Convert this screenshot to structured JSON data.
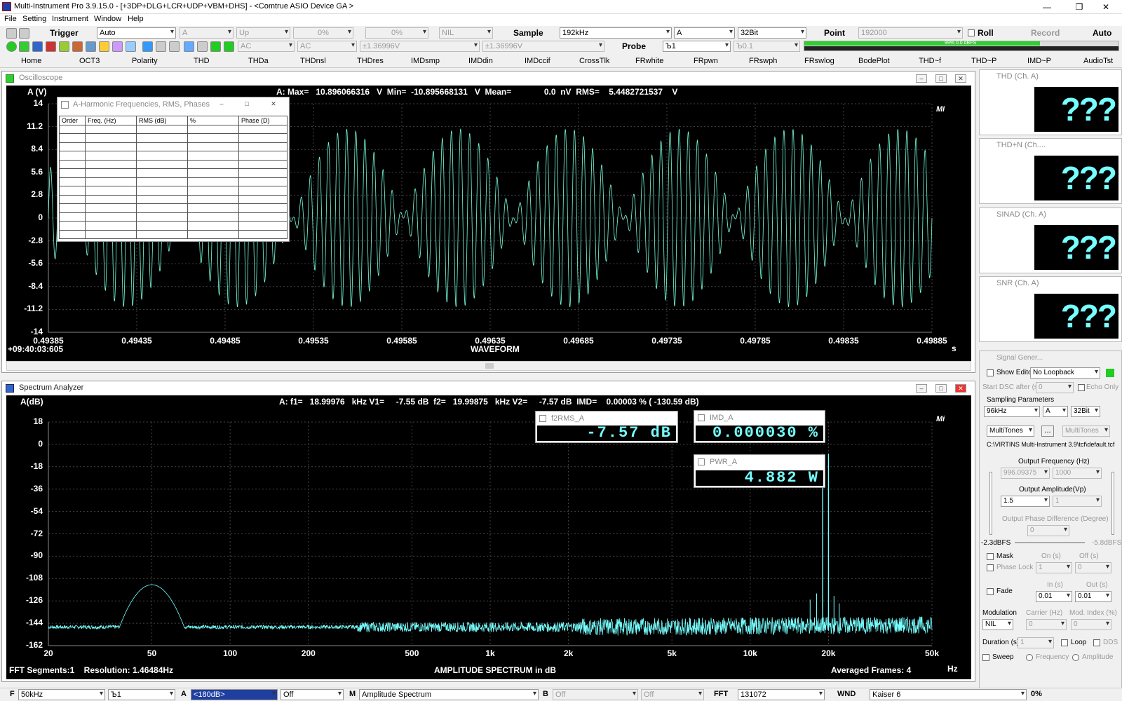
{
  "app": {
    "title": "Multi-Instrument Pro 3.9.15.0  -  [+3DP+DLG+LCR+UDP+VBM+DHS]  -  <Comtrue ASIO Device GA >"
  },
  "menu": [
    "File",
    "Setting",
    "Instrument",
    "Window",
    "Help"
  ],
  "toolbar1": {
    "trigger_label": "Trigger",
    "trigger_mode": "Auto",
    "channel": "A",
    "direction": "Up",
    "level1": "0%",
    "level2": "0%",
    "nil": "NIL",
    "sample_label": "Sample",
    "sample_rate": "192kHz",
    "sample_channel": "A",
    "bits": "32Bit",
    "point_label": "Point",
    "points": "192000",
    "roll_label": "Roll",
    "record_label": "Record",
    "auto_label": "Auto"
  },
  "toolbar2": {
    "coupling_a": "AC",
    "coupling_b": "AC",
    "range_a": "±1.36996V",
    "range_b": "±1.36996V",
    "probe_label": "Probe",
    "probe_a": "Ъ1",
    "probe_b": "Ъ0.1",
    "level_text": "99%  0.0 dBFS",
    "level_fraction": 0.75
  },
  "tabs": [
    "Home",
    "OCT3",
    "Polarity",
    "THD",
    "THDa",
    "THDnsl",
    "THDres",
    "IMDsmp",
    "IMDdin",
    "IMDccif",
    "CrossTlk",
    "FRwhite",
    "FRpwn",
    "FRswph",
    "FRswlog",
    "BodePlot",
    "THD~f",
    "THD~P",
    "IMD~P",
    "AudioTst"
  ],
  "osc": {
    "title": "Oscilloscope",
    "ylabel": "A (V)",
    "info": "A: Max=   10.896066316   V  Min=  -10.895668131   V  Mean=              0.0  nV  RMS=    5.4482721537    V",
    "yticks": [
      "14",
      "11.2",
      "8.4",
      "5.6",
      "2.8",
      "0",
      "-2.8",
      "-5.6",
      "-8.4",
      "-11.2",
      "-14"
    ],
    "xticks": [
      "0.49385",
      "0.49435",
      "0.49485",
      "0.49535",
      "0.49585",
      "0.49635",
      "0.49685",
      "0.49735",
      "0.49785",
      "0.49835",
      "0.49885"
    ],
    "xunit": "s",
    "time": "+09:40:03:605",
    "caption": "WAVEFORM",
    "logo": "Mi"
  },
  "harm": {
    "title": "A-Harmonic Frequencies, RMS, Phases",
    "headers": [
      "Order",
      "Freq. (Hz)",
      "RMS (dB)",
      "%",
      "Phase (D)"
    ]
  },
  "spec": {
    "title": "Spectrum Analyzer",
    "ylabel": "A(dB)",
    "info": "A: f1=   18.99976   kHz V1=     -7.55 dB  f2=   19.99875   kHz V2=     -7.57 dB  IMD=    0.00003 % ( -130.59 dB)",
    "yticks": [
      "18",
      "0",
      "-18",
      "-36",
      "-54",
      "-72",
      "-90",
      "-108",
      "-126",
      "-144",
      "-162"
    ],
    "xticks": [
      "20",
      "50",
      "100",
      "200",
      "500",
      "1k",
      "2k",
      "5k",
      "10k",
      "20k",
      "50k"
    ],
    "xunit": "Hz",
    "caption": "AMPLITUDE SPECTRUM in dB",
    "fft_info": "FFT Segments:1    Resolution: 1.46484Hz",
    "avg": "Averaged Frames: 4",
    "logo": "Mi"
  },
  "readouts": {
    "f2rms": {
      "title": "f2RMS_A",
      "value": "-7.57 dB"
    },
    "imd": {
      "title": "IMD_A",
      "value": "0.000030 %"
    },
    "pwr": {
      "title": "PWR_A",
      "value": "4.882 W"
    }
  },
  "meters": [
    {
      "title": "THD (Ch. A)",
      "value": "???"
    },
    {
      "title": "THD+N (Ch....",
      "value": "???"
    },
    {
      "title": "SINAD (Ch. A)",
      "value": "???"
    },
    {
      "title": "SNR (Ch. A)",
      "value": "???"
    }
  ],
  "siggen": {
    "title": "Signal Gener...",
    "show_editor": "Show Editor",
    "loopback": "No Loopback",
    "start_osc": "Start DSC after (s)",
    "start_val": "0",
    "echo": "Echo Only",
    "sampling_params": "Sampling Parameters",
    "rate": "96kHz",
    "ch": "A",
    "bits": "32Bit",
    "mode": "MultiTones",
    "mode2": "MultiTones",
    "path": "C:\\VIRTINS Multi-Instrument 3.9\\tcf\\default.tcf",
    "out_freq_label": "Output Frequency (Hz)",
    "freq1": "996.09375",
    "freq2": "1000",
    "out_amp_label": "Output Amplitude(Vp)",
    "amp1": "1.5",
    "amp2": "1",
    "phase_label": "Output Phase Difference (Degree)",
    "phase": "0",
    "dbfs_left": "-2.3dBFS",
    "dbfs_right": "-5.8dBFS",
    "mask": "Mask",
    "on_s": "On (s)",
    "off_s": "Off (s)",
    "phase_lock": "Phase Lock",
    "pl1": "1",
    "pl2": "0",
    "fade": "Fade",
    "in_s": "In (s)",
    "out_s": "Out (s)",
    "fade_in": "0.01",
    "fade_out": "0.01",
    "modulation": "Modulation",
    "carrier": "Carrier (Hz)",
    "mod_index": "Mod. Index (%)",
    "mod_type": "NIL",
    "carrier_val": "0",
    "mod_val": "0",
    "duration": "Duration (s)",
    "dur_val": "1",
    "loop": "Loop",
    "dds": "DDS",
    "sweep": "Sweep",
    "frequency": "Frequency",
    "amplitude": "Amplitude"
  },
  "status": {
    "f_label": "F",
    "f_val": "50kHz",
    "probe": "Ъ1",
    "a_label": "A",
    "a_val": "<180dB>",
    "a_off": "Off",
    "m_label": "M",
    "m_val": "Amplitude Spectrum",
    "b_label": "B",
    "b_off1": "Off",
    "b_off2": "Off",
    "fft_label": "FFT",
    "fft_val": "131072",
    "wnd_label": "WND",
    "wnd_val": "Kaiser 6",
    "pct": "0%"
  }
}
